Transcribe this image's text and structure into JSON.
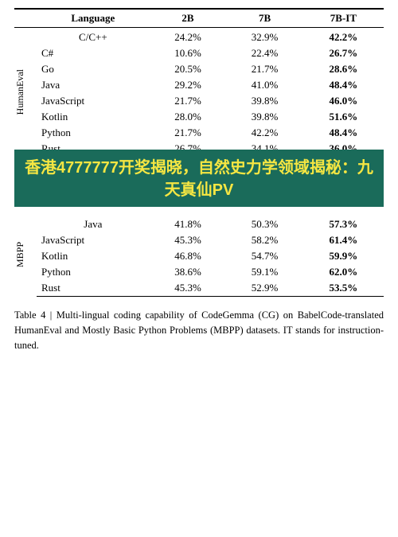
{
  "table": {
    "caption": "Table 4",
    "description": "Multi-lingual coding capability of CodeGemma (CG) on BabelCode-translated HumanEval and Mostly Basic Python Problems (MBPP) datasets. IT stands for instruction-tuned.",
    "headers": [
      "Language",
      "2B",
      "7B",
      "7B-IT"
    ],
    "humaneval_label": "HumanEval",
    "mbpp_label": "MBPP",
    "humaneval_rows": [
      {
        "lang": "C/C++",
        "b2": "24.2%",
        "b7": "32.9%",
        "b7it": "42.2%"
      },
      {
        "lang": "C#",
        "b2": "10.6%",
        "b7": "22.4%",
        "b7it": "26.7%"
      },
      {
        "lang": "Go",
        "b2": "20.5%",
        "b7": "21.7%",
        "b7it": "28.6%"
      },
      {
        "lang": "Java",
        "b2": "29.2%",
        "b7": "41.0%",
        "b7it": "48.4%"
      },
      {
        "lang": "JavaScript",
        "b2": "21.7%",
        "b7": "39.8%",
        "b7it": "46.0%"
      },
      {
        "lang": "Kotlin",
        "b2": "28.0%",
        "b7": "39.8%",
        "b7it": "51.6%"
      },
      {
        "lang": "Python",
        "b2": "21.7%",
        "b7": "42.2%",
        "b7it": "48.4%"
      },
      {
        "lang": "Rust",
        "b2": "26.7%",
        "b7": "34.1%",
        "b7it": "36.0%"
      }
    ],
    "mbpp_rows": [
      {
        "lang": "Java",
        "b2": "41.8%",
        "b7": "50.3%",
        "b7it": "57.3%"
      },
      {
        "lang": "JavaScript",
        "b2": "45.3%",
        "b7": "58.2%",
        "b7it": "61.4%"
      },
      {
        "lang": "Kotlin",
        "b2": "46.8%",
        "b7": "54.7%",
        "b7it": "59.9%"
      },
      {
        "lang": "Python",
        "b2": "38.6%",
        "b7": "59.1%",
        "b7it": "62.0%"
      },
      {
        "lang": "Rust",
        "b2": "45.3%",
        "b7": "52.9%",
        "b7it": "53.5%"
      }
    ]
  },
  "ad": {
    "text": "香港4777777开奖揭晓，自然史力学领域揭秘：九天真仙PV"
  },
  "footer": {
    "text": "Table 4 | Multi-lingual coding capability of CodeGemma (CG) on BabelCode-translated HumanEval and Mostly Basic Python Problems (MBPP) datasets. IT stands for instruction-tuned."
  }
}
